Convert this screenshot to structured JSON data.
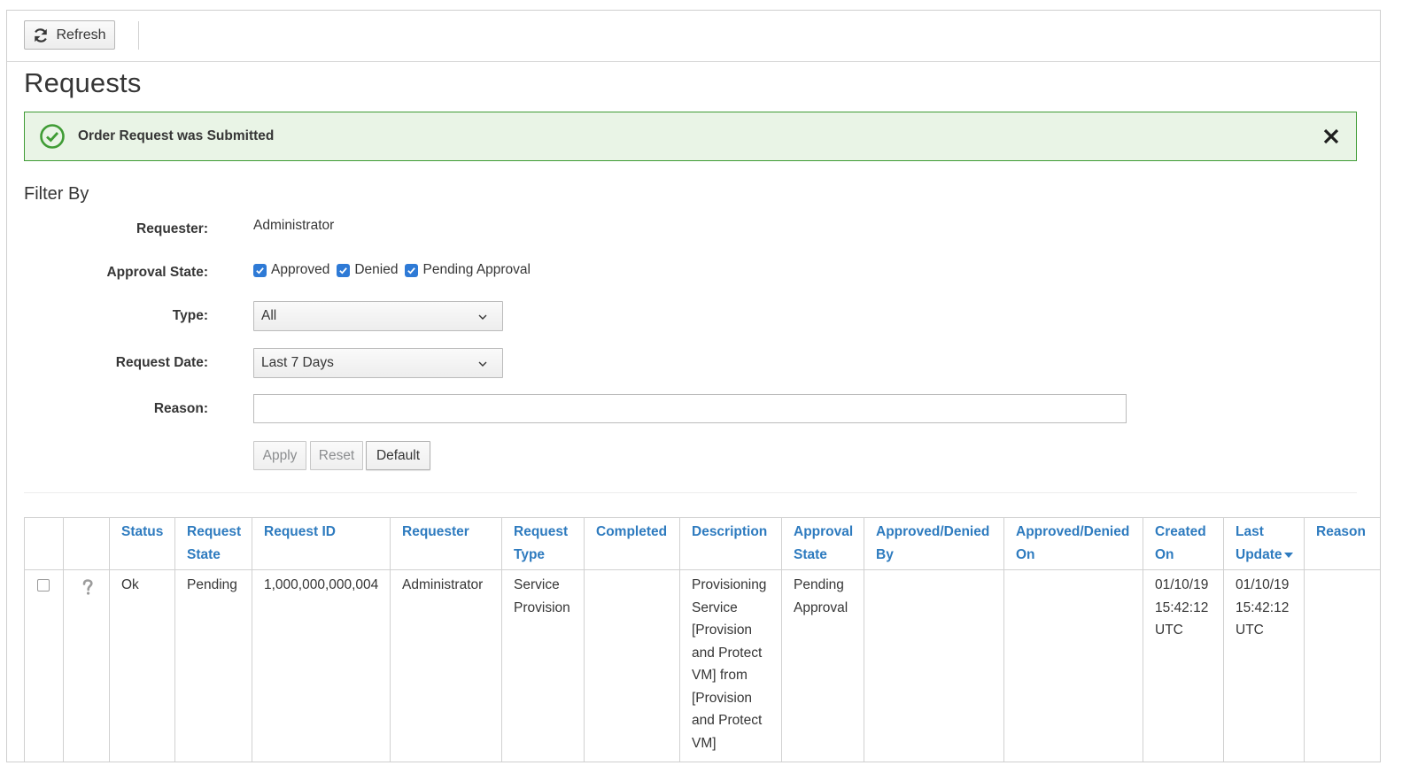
{
  "toolbar": {
    "refresh_label": "Refresh"
  },
  "page": {
    "title": "Requests"
  },
  "alert": {
    "message": "Order Request was Submitted",
    "type": "success",
    "color": "#3f9c35"
  },
  "filter": {
    "title": "Filter By",
    "requester_label": "Requester:",
    "requester_value": "Administrator",
    "approval_state_label": "Approval State:",
    "approval_options": [
      {
        "label": "Approved",
        "checked": true
      },
      {
        "label": "Denied",
        "checked": true
      },
      {
        "label": "Pending Approval",
        "checked": true
      }
    ],
    "type_label": "Type:",
    "type_value": "All",
    "request_date_label": "Request Date:",
    "request_date_value": "Last 7 Days",
    "reason_label": "Reason:",
    "reason_value": "",
    "apply_label": "Apply",
    "reset_label": "Reset",
    "default_label": "Default"
  },
  "table": {
    "columns": [
      "",
      "",
      "Status",
      "Request State",
      "Request ID",
      "Requester",
      "Request Type",
      "Completed",
      "Description",
      "Approval State",
      "Approved/Denied By",
      "Approved/Denied On",
      "Created On",
      "Last Update",
      "Reason"
    ],
    "sorted_column": "Last Update",
    "rows": [
      {
        "status_icon": "question-icon",
        "status": "Ok",
        "request_state": "Pending",
        "request_id": "1,000,000,000,004",
        "requester": "Administrator",
        "request_type": "Service Provision",
        "completed": "",
        "description": "Provisioning Service [Provision and Protect VM] from [Provision and Protect VM]",
        "approval_state": "Pending Approval",
        "approved_denied_by": "",
        "approved_denied_on": "",
        "created_on": "01/10/19 15:42:12 UTC",
        "last_update": "01/10/19 15:42:12 UTC",
        "reason": ""
      }
    ]
  },
  "colors": {
    "accent": "#2e7bbf",
    "checkbox": "#2e7ad6",
    "alert_bg": "#e9f4e6"
  }
}
